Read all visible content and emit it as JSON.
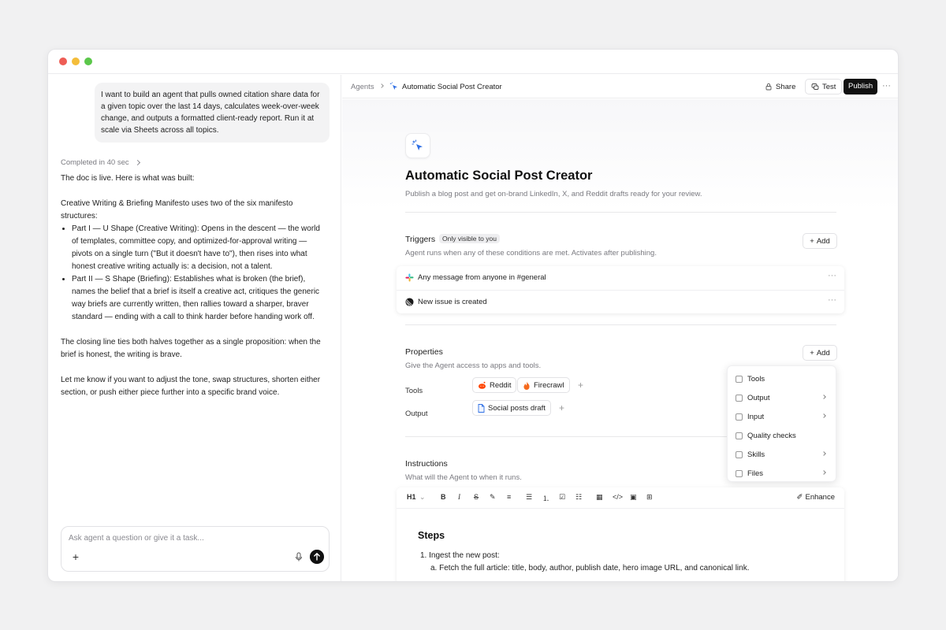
{
  "chat": {
    "user_message": "I want to build an agent that pulls owned citation share data for a given topic over the last 14 days, calculates week-over-week change, and outputs a formatted client-ready report. Run it at scale via Sheets across all topics.",
    "completed": "Completed in 40 sec",
    "reply": {
      "intro": "The doc is live. Here is what was built:",
      "p1": "Creative Writing & Briefing Manifesto uses two of the six manifesto structures:",
      "bullets": [
        "Part I — U Shape (Creative Writing): Opens in the descent — the world of templates, committee copy, and optimized-for-approval writing — pivots on a single turn (\"But it doesn't have to\"), then rises into what honest creative writing actually is: a decision, not a talent.",
        "Part II — S Shape (Briefing): Establishes what is broken (the brief), names the belief that a brief is itself a creative act, critiques the generic way briefs are currently written, then rallies toward a sharper, braver standard — ending with a call to think harder before handing work off."
      ],
      "p2": "The closing line ties both halves together as a single proposition: when the brief is honest, the writing is brave.",
      "p3": "Let me know if you want to adjust the tone, swap structures, shorten either section, or push either piece further into a specific brand voice."
    },
    "input_placeholder": "Ask agent a question or give it a task..."
  },
  "topbar": {
    "crumb_root": "Agents",
    "crumb_current": "Automatic Social Post Creator",
    "share": "Share",
    "test": "Test",
    "publish": "Publish",
    "more": "···"
  },
  "agent": {
    "title": "Automatic Social Post Creator",
    "description": "Publish a blog post and get on-brand LinkedIn, X, and Reddit drafts ready for your review."
  },
  "triggers": {
    "title": "Triggers",
    "badge": "Only visible to you",
    "subtitle": "Agent runs when any of these conditions are met. Activates after publishing.",
    "add": "Add",
    "items": [
      {
        "label": "Any message from anyone in #general",
        "icon": "slack-icon"
      },
      {
        "label": "New issue is created",
        "icon": "linear-icon"
      }
    ]
  },
  "properties": {
    "title": "Properties",
    "subtitle": "Give the Agent access to apps and tools.",
    "add": "Add",
    "tools_label": "Tools",
    "tools": [
      "Reddit",
      "Firecrawl"
    ],
    "output_label": "Output",
    "output": "Social posts draft"
  },
  "add_menu": {
    "items": [
      "Tools",
      "Output",
      "Input",
      "Quality checks",
      "Skills",
      "Files"
    ]
  },
  "instructions": {
    "title": "Instructions",
    "subtitle": "What will the Agent to when it runs.",
    "heading_select": "H1",
    "enhance": "Enhance",
    "steps_heading": "Steps",
    "step1": "Ingest the new post:",
    "step1a": "Fetch the full article: title, body, author, publish date, hero image URL, and canonical link."
  },
  "colors": {
    "accent": "#2f6fe4",
    "publish_bg": "#111111",
    "reddit": "#ff4500",
    "firecrawl": "#f56a1d"
  }
}
